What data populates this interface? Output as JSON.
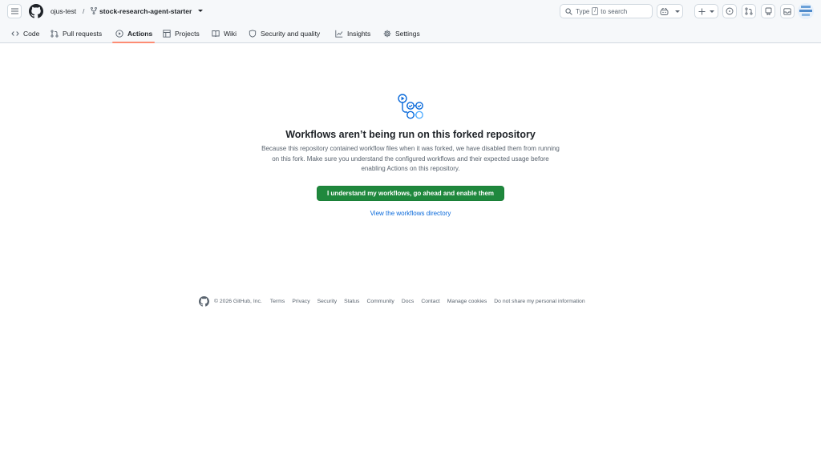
{
  "header": {
    "breadcrumb": {
      "owner": "ojus-test",
      "separator": "/",
      "repo": "stock-research-agent-starter"
    },
    "search": {
      "prefix": "Type",
      "key": "/",
      "suffix": "to search"
    },
    "icons": [
      "menu-icon",
      "github-logo-icon",
      "fork-icon",
      "search-icon",
      "copilot-icon",
      "plus-icon",
      "issues-icon",
      "pull-requests-icon",
      "notifications-icon",
      "inbox-icon"
    ]
  },
  "nav": {
    "tabs": [
      {
        "label": "Code",
        "icon": "code-icon"
      },
      {
        "label": "Pull requests",
        "icon": "pull-request-icon"
      },
      {
        "label": "Actions",
        "icon": "play-icon",
        "active": true
      },
      {
        "label": "Projects",
        "icon": "table-icon"
      },
      {
        "label": "Wiki",
        "icon": "book-icon"
      },
      {
        "label": "Security and quality",
        "icon": "shield-icon"
      },
      {
        "label": "Insights",
        "icon": "graph-icon"
      },
      {
        "label": "Settings",
        "icon": "gear-icon"
      }
    ]
  },
  "main": {
    "heading": "Workflows aren’t being run on this forked repository",
    "description_lines": [
      "Because this repository contained workflow files when it was forked, we have disabled them from running",
      "on this fork. Make sure you understand the configured workflows and their expected usage before",
      "enabling Actions on this repository."
    ],
    "enable_button": "I understand my workflows, go ahead and enable them",
    "directory_link": "View the workflows directory"
  },
  "footer": {
    "copyright": "© 2026 GitHub, Inc.",
    "links": [
      "Terms",
      "Privacy",
      "Security",
      "Status",
      "Community",
      "Docs",
      "Contact",
      "Manage cookies",
      "Do not share my personal information"
    ]
  },
  "colors": {
    "accent_green": "#1f883d",
    "link_blue": "#0969da",
    "active_underline": "#fd8c73",
    "muted_text": "#59636e"
  }
}
